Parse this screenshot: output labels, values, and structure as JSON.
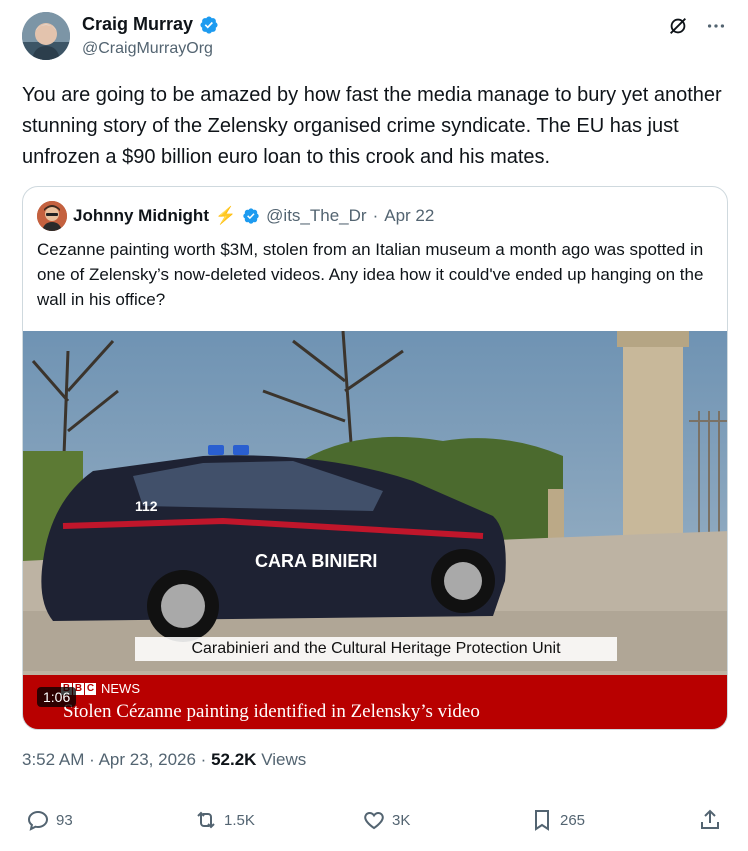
{
  "author": {
    "display_name": "Craig Murray",
    "handle": "@CraigMurrayOrg"
  },
  "tweet_text": "You are going to be amazed by how fast the media manage to bury yet another stunning story of the Zelensky organised crime syndicate. The EU has just unfrozen a $90 billion euro loan to this crook and his mates.",
  "quote": {
    "display_name": "Johnny Midnight",
    "emoji": "⚡",
    "handle": "@its_The_Dr",
    "separator": "·",
    "date": "Apr 22",
    "text": "Cezanne painting worth $3M, stolen from an Italian museum a month ago was spotted in one of Zelensky’s now-deleted videos. Any idea how it could've ended up hanging on the wall in his office?",
    "media": {
      "car_number": "112",
      "car_text": "CARA BINIERI",
      "caption": "Carabinieri and the Cultural Heritage Protection Unit",
      "bbc_brand": "BBC",
      "bbc_news_label": "NEWS",
      "headline": "Stolen Cézanne painting identified in Zelensky’s video",
      "duration": "1:06"
    }
  },
  "meta": {
    "time": "3:52 AM",
    "separator": "·",
    "date": "Apr 23, 2026",
    "views_count": "52.2K",
    "views_label": "Views"
  },
  "actions": {
    "replies": "93",
    "reposts": "1.5K",
    "likes": "3K",
    "bookmarks": "265"
  },
  "icons": {
    "verified": "verified-badge-icon",
    "grok": "grok-icon",
    "more": "more-icon",
    "reply": "reply-icon",
    "repost": "repost-icon",
    "like": "heart-icon",
    "bookmark": "bookmark-icon",
    "share": "share-icon"
  },
  "colors": {
    "verified_blue": "#1d9bf0",
    "secondary_text": "#536471",
    "bbc_red": "#b80000"
  }
}
